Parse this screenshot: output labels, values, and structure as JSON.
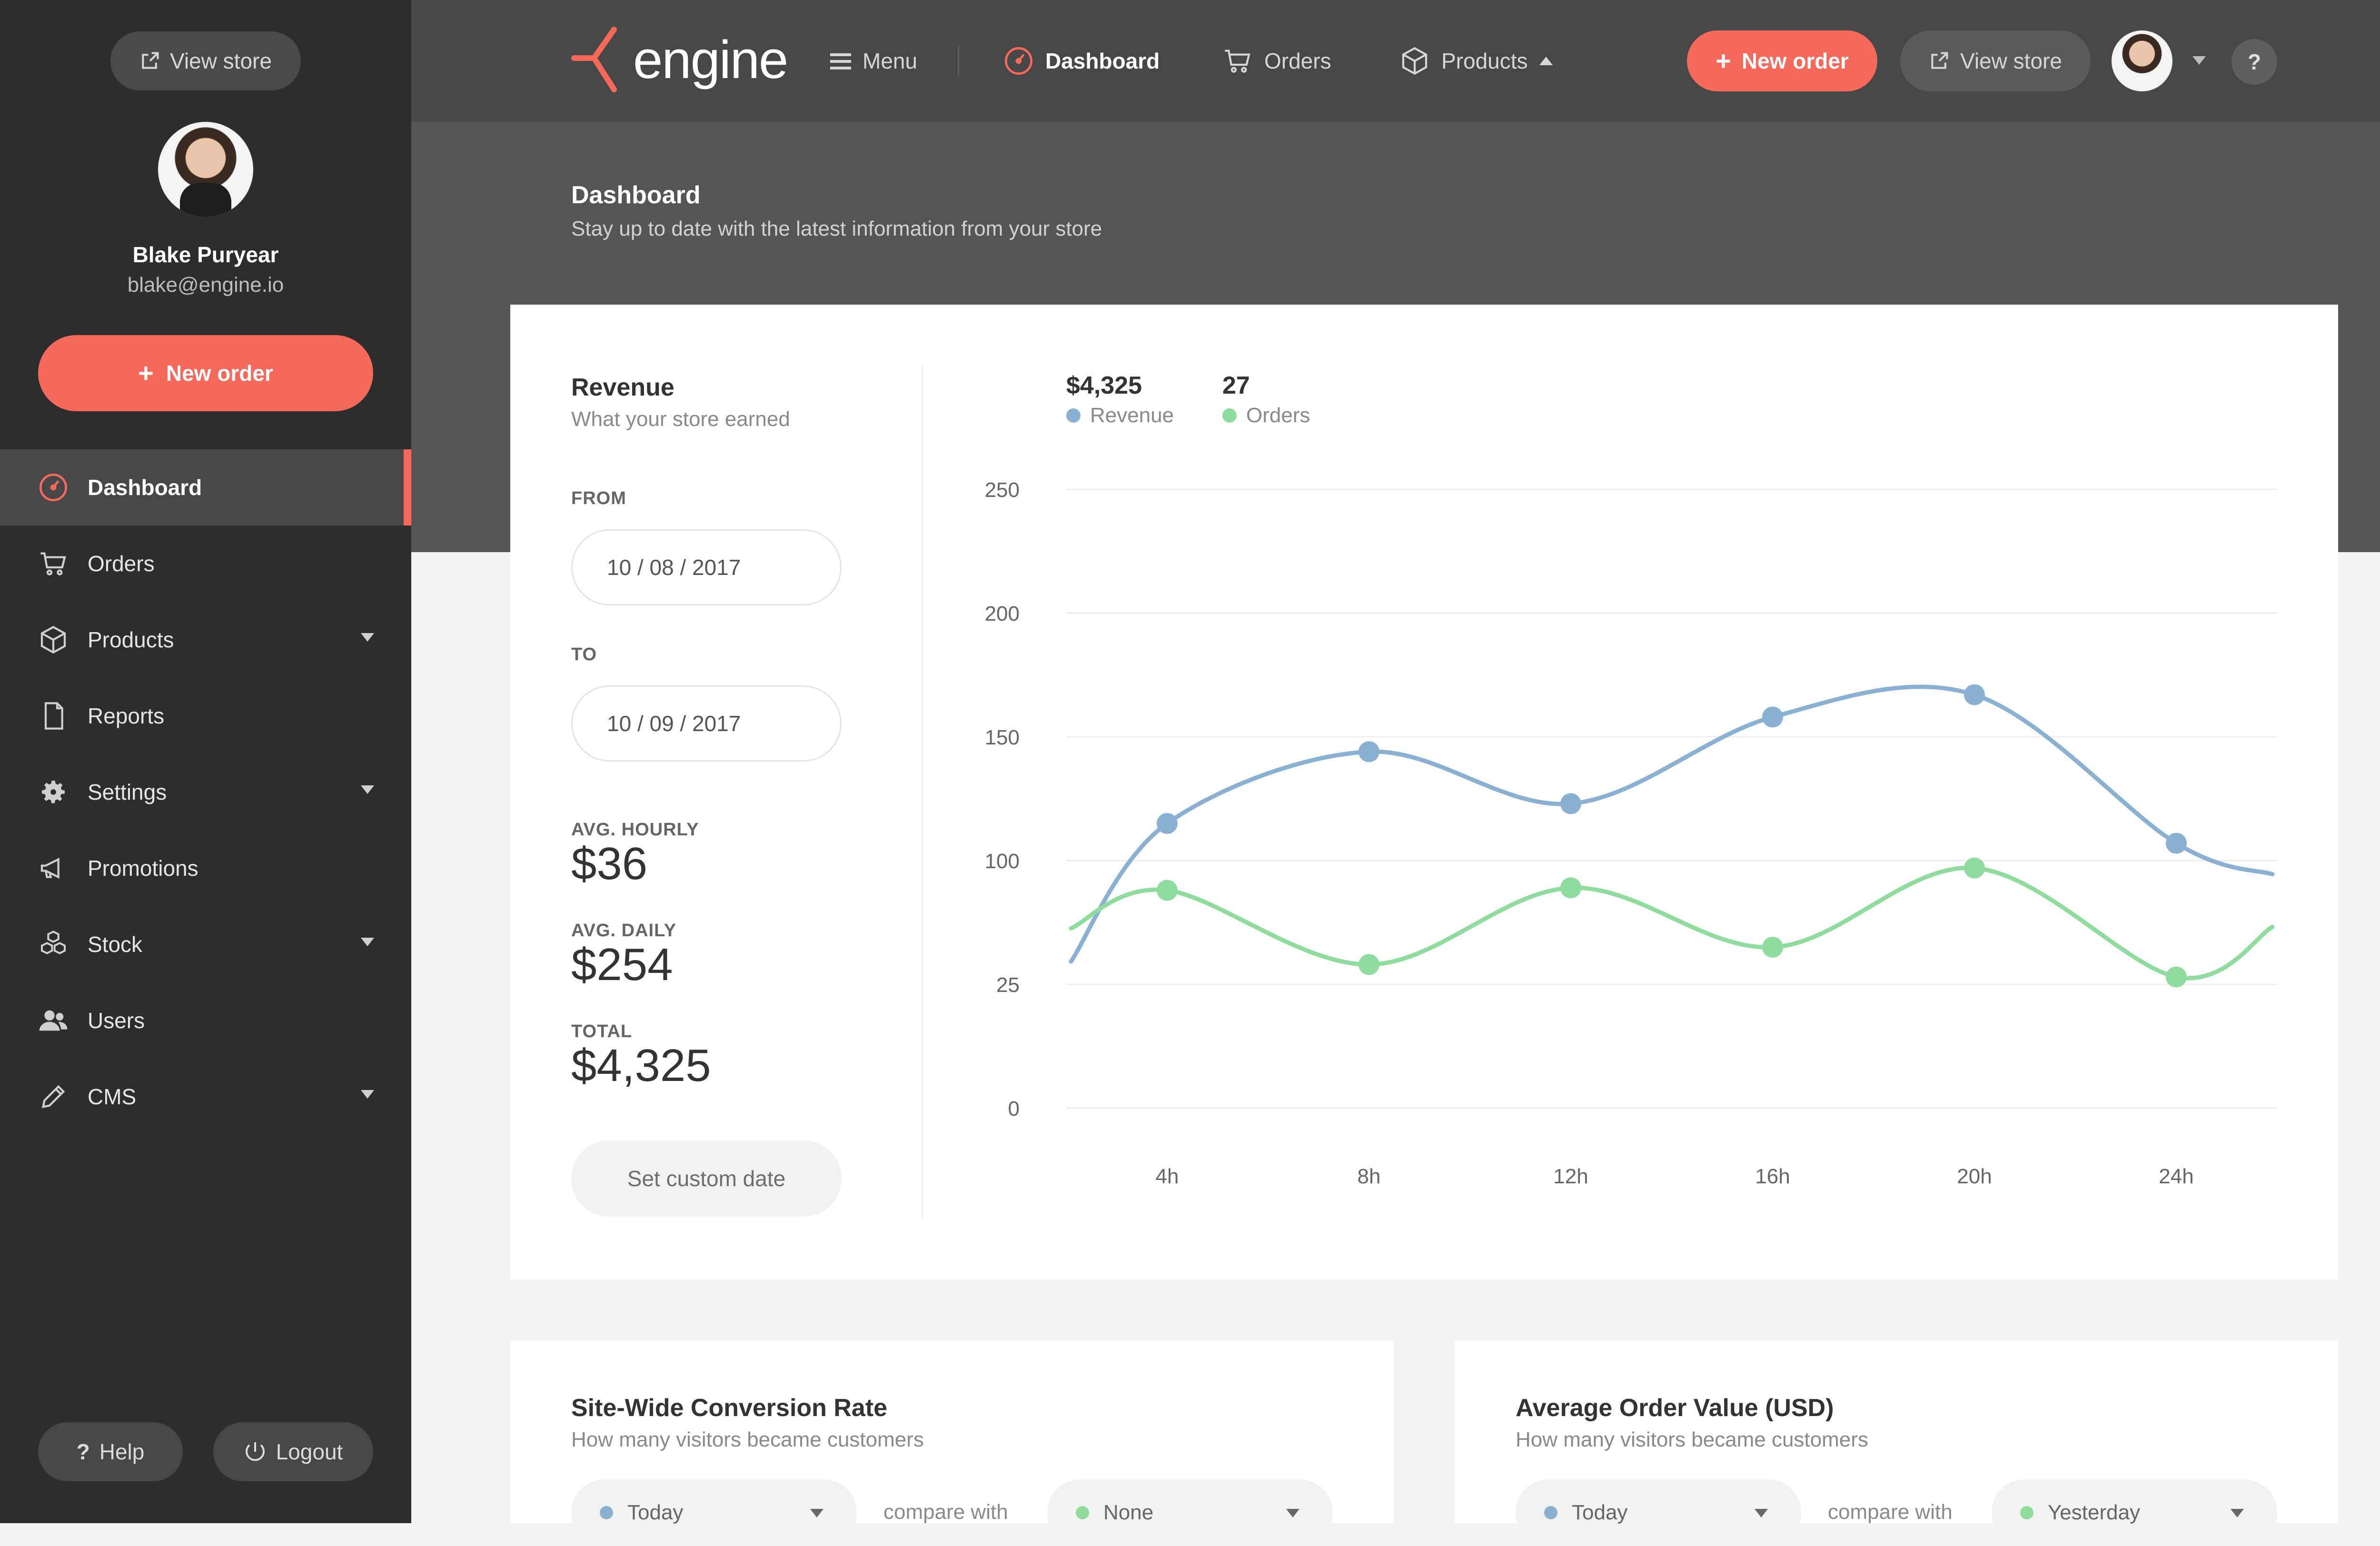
{
  "sidebar": {
    "view_store": "View store",
    "user_name": "Blake Puryear",
    "user_email": "blake@engine.io",
    "new_order": "New order",
    "items": [
      {
        "label": "Dashboard",
        "icon": "dashboard-gauge-icon",
        "active": true
      },
      {
        "label": "Orders",
        "icon": "cart-icon"
      },
      {
        "label": "Products",
        "icon": "box-icon",
        "has_submenu": true
      },
      {
        "label": "Reports",
        "icon": "document-icon"
      },
      {
        "label": "Settings",
        "icon": "gear-icon",
        "has_submenu": true
      },
      {
        "label": "Promotions",
        "icon": "megaphone-icon"
      },
      {
        "label": "Stock",
        "icon": "stacked-boxes-icon",
        "has_submenu": true
      },
      {
        "label": "Users",
        "icon": "users-icon"
      },
      {
        "label": "CMS",
        "icon": "pencil-icon",
        "has_submenu": true
      }
    ],
    "help": "Help",
    "logout": "Logout"
  },
  "topbar": {
    "logo_text": "engine",
    "menu": "Menu",
    "dashboard": "Dashboard",
    "orders": "Orders",
    "products": "Products",
    "new_order": "New order",
    "view_store": "View store",
    "help": "?"
  },
  "header": {
    "title": "Dashboard",
    "subtitle": "Stay up to date with the latest information from your store"
  },
  "revenue": {
    "title": "Revenue",
    "subtitle": "What your store earned",
    "from_label": "FROM",
    "from_date": "10 / 08 / 2017",
    "to_label": "TO",
    "to_date": "10 / 09 / 2017",
    "avg_hourly_label": "AVG. HOURLY",
    "avg_hourly": "$36",
    "avg_daily_label": "AVG. DAILY",
    "avg_daily": "$254",
    "total_label": "TOTAL",
    "total": "$4,325",
    "custom_date": "Set custom date",
    "legend": [
      {
        "value": "$4,325",
        "name": "Revenue",
        "color": "#8ab0d2"
      },
      {
        "value": "27",
        "name": "Orders",
        "color": "#8fdc9e"
      }
    ]
  },
  "chart_data": {
    "type": "line",
    "categories": [
      "4h",
      "8h",
      "12h",
      "16h",
      "20h",
      "24h"
    ],
    "y_ticks": [
      "0",
      "25",
      "100",
      "150",
      "200",
      "250"
    ],
    "y_tick_values": [
      0,
      50,
      100,
      150,
      200,
      250
    ],
    "ylim": [
      0,
      250
    ],
    "grid": true,
    "series": [
      {
        "name": "Revenue",
        "color": "#8ab0d2",
        "values": [
          115,
          144,
          123,
          158,
          167,
          107
        ]
      },
      {
        "name": "Orders",
        "color": "#8fdc9e",
        "values": [
          88,
          58,
          89,
          65,
          97,
          53
        ]
      }
    ]
  },
  "conversion": {
    "title": "Site-Wide Conversion Rate",
    "subtitle": "How many visitors became customers",
    "range": "Today",
    "compare_label": "compare with",
    "compare_value": "None"
  },
  "aov": {
    "title": "Average Order Value (USD)",
    "subtitle": "How many visitors became customers",
    "range": "Today",
    "compare_label": "compare with",
    "compare_value": "Yesterday"
  }
}
